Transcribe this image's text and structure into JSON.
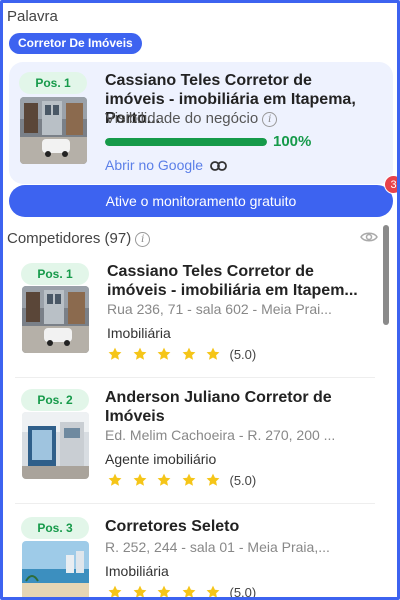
{
  "keyword": {
    "label": "Palavra",
    "chip": "Corretor De Imóveis"
  },
  "top_result": {
    "position": "Pos. 1",
    "name": "Cassiano Teles Corretor de imóveis - imobiliária em Itapema, Porto...",
    "visibility_label": "Visibilidade do negócio",
    "visibility_percent": 100,
    "visibility_text": "100%",
    "google_link": "Abrir no Google"
  },
  "monitor_button": "Ative o monitoramento gratuito",
  "notification_count": "3",
  "competitors": {
    "title": "Competidores (97)",
    "items": [
      {
        "position": "Pos. 1",
        "name": "Cassiano Teles Corretor de imóveis - imobiliária em Itapem...",
        "address": "Rua 236, 71 - sala 602 - Meia Prai...",
        "category": "Imobiliária",
        "rating": 5.0,
        "rating_text": "(5.0)"
      },
      {
        "position": "Pos. 2",
        "name": "Anderson Juliano Corretor de Imóveis",
        "address": "Ed. Melim Cachoeira - R. 270, 200 ...",
        "category": "Agente imobiliário",
        "rating": 5.0,
        "rating_text": "(5.0)"
      },
      {
        "position": "Pos. 3",
        "name": "Corretores Seleto",
        "address": "R. 252, 244 - sala 01 - Meia Praia,...",
        "category": "Imobiliária",
        "rating": 5.0,
        "rating_text": "(5.0)"
      }
    ]
  },
  "colors": {
    "accent": "#3d63f0",
    "success": "#169a4a",
    "star": "#f5c518",
    "badge": "#e8424b"
  }
}
